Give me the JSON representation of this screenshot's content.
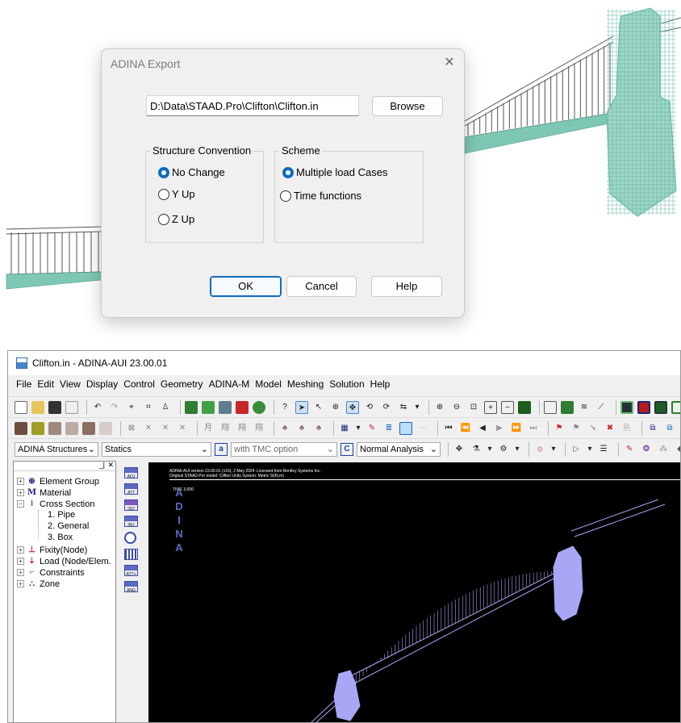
{
  "export_dialog": {
    "title": "ADINA Export",
    "file_path": "D:\\Data\\STAAD.Pro\\Clifton\\Clifton.in",
    "browse_label": "Browse",
    "structure_convention": {
      "legend": "Structure Convention",
      "options": [
        "No Change",
        "Y Up",
        "Z Up"
      ],
      "selected": "No Change"
    },
    "scheme": {
      "legend": "Scheme",
      "options": [
        "Multiple load Cases",
        "Time functions"
      ],
      "selected": "Multiple load Cases"
    },
    "ok_label": "OK",
    "cancel_label": "Cancel",
    "help_label": "Help"
  },
  "adina_window": {
    "title": "Clifton.in - ADINA-AUI  23.00.01",
    "menu": [
      "File",
      "Edit",
      "View",
      "Display",
      "Control",
      "Geometry",
      "ADINA-M",
      "Model",
      "Meshing",
      "Solution",
      "Help"
    ],
    "combos": {
      "program": "ADINA Structures",
      "analysis": "Statics",
      "tmc": "with TMC option",
      "analysis_type": "Normal Analysis"
    },
    "tree": [
      {
        "label": "Element Group",
        "expander": "+",
        "icon": "circle-grid-icon"
      },
      {
        "label": "Material",
        "expander": "+",
        "icon": "material-m-icon"
      },
      {
        "label": "Cross Section",
        "expander": "-",
        "icon": "i-beam-icon"
      },
      {
        "label": "1. Pipe",
        "child": true
      },
      {
        "label": "2. General",
        "child": true
      },
      {
        "label": "3. Box",
        "child": true
      },
      {
        "label": "Fixity(Node)",
        "expander": "+",
        "icon": "fixity-icon"
      },
      {
        "label": "Load (Node/Elem.",
        "expander": "+",
        "icon": "load-icon"
      },
      {
        "label": "Constraints",
        "expander": "+",
        "icon": "constraints-icon"
      },
      {
        "label": "Zone",
        "expander": "+",
        "icon": "zone-icon"
      }
    ],
    "side_toolbar": [
      "ADJ",
      "ATT",
      "ISO",
      "INV",
      "",
      "",
      "ATT+",
      "ANG"
    ],
    "viewport": {
      "header_line1": "ADINA-AUI version 23.00.01 (v16), 2 May 2024: Licensed from Bentley Systems Inc.",
      "header_line2": "Original STAAD.Pro model: Clifton Units System: Metric SI(N,m)",
      "time_label": "TIME 3.000",
      "logo": [
        "A",
        "D",
        "I",
        "N",
        "A"
      ],
      "mesh_color": "#a9a6f5"
    }
  },
  "colors": {
    "staad_mesh": "#5fb3a3",
    "accent_blue": "#0f6cbd"
  }
}
